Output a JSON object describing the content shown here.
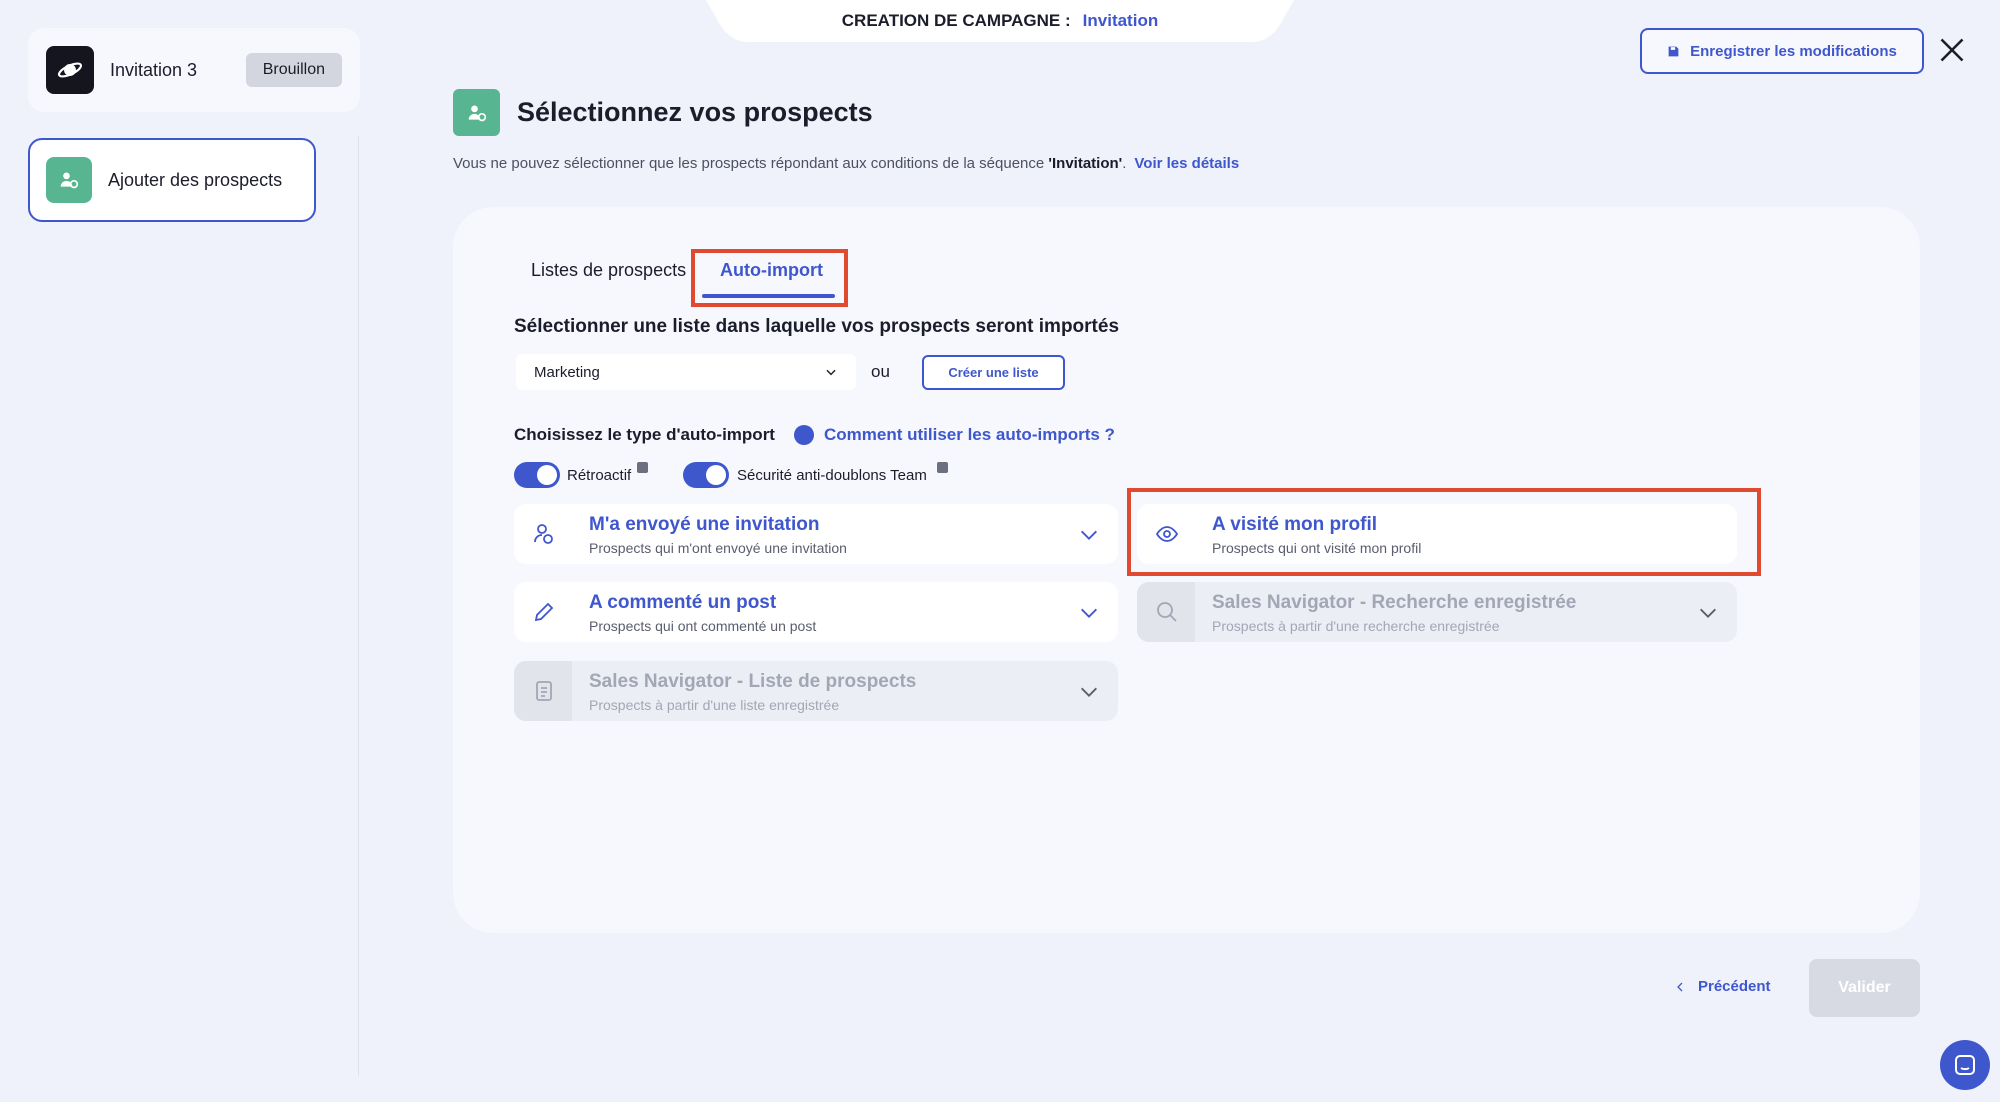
{
  "sidebar": {
    "campaign_name": "Invitation 3",
    "campaign_status": "Brouillon",
    "step_label": "Ajouter des prospects"
  },
  "topbar": {
    "label": "CREATION DE CAMPAGNE :",
    "value": "Invitation",
    "save_label": "Enregistrer les modifications"
  },
  "header": {
    "title": "Sélectionnez vos prospects",
    "subtitle_pre": "Vous ne pouvez sélectionner que les prospects répondant aux conditions de la séquence ",
    "subtitle_seq": "'Invitation'",
    "subtitle_post": ".",
    "details_link": "Voir les détails"
  },
  "tabs": [
    {
      "label": "Listes de prospects",
      "active": false
    },
    {
      "label": "Auto-import",
      "active": true
    }
  ],
  "list_select": {
    "title": "Sélectionner une liste dans laquelle vos prospects seront importés",
    "value": "Marketing",
    "or_label": "ou",
    "create_label": "Créer une liste"
  },
  "autoimport": {
    "title": "Choisissez le type d'auto-import",
    "help_link": "Comment utiliser les auto-imports ?",
    "toggles": [
      {
        "label": "Rétroactif",
        "on": true
      },
      {
        "label": "Sécurité anti-doublons Team",
        "on": true
      }
    ],
    "options": [
      {
        "title": "M'a envoyé une invitation",
        "subtitle": "Prospects qui m'ont envoyé une invitation",
        "icon": "user-invite-icon",
        "enabled": true
      },
      {
        "title": "A visité mon profil",
        "subtitle": "Prospects qui ont visité mon profil",
        "icon": "eye-icon",
        "enabled": true
      },
      {
        "title": "A commenté un post",
        "subtitle": "Prospects qui ont commenté un post",
        "icon": "pencil-icon",
        "enabled": true
      },
      {
        "title": "Sales Navigator - Recherche enregistrée",
        "subtitle": "Prospects à partir d'une recherche enregistrée",
        "icon": "search-icon",
        "enabled": false
      },
      {
        "title": "Sales Navigator - Liste de prospects",
        "subtitle": "Prospects à partir d'une liste enregistrée",
        "icon": "list-icon",
        "enabled": false
      }
    ]
  },
  "footer": {
    "prev_label": "Précédent",
    "validate_label": "Valider"
  },
  "colors": {
    "accent": "#3f57cd",
    "green": "#58b591",
    "highlight": "#e04a30",
    "background": "#eff1fb"
  }
}
